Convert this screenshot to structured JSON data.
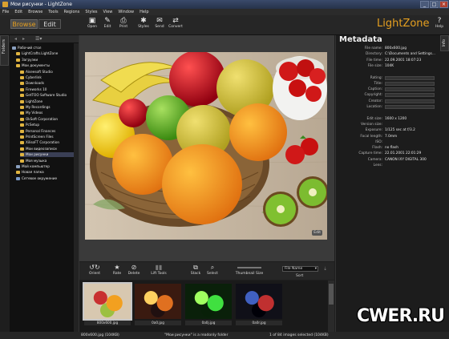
{
  "window": {
    "title": "Мои рисунки - LightZone"
  },
  "menu": [
    "File",
    "Edit",
    "Browse",
    "Tools",
    "Regions",
    "Styles",
    "View",
    "Window",
    "Help"
  ],
  "modes": {
    "browse": "Browse",
    "edit": "Edit"
  },
  "toolbar": [
    {
      "icon": "open-icon",
      "label": "Open"
    },
    {
      "icon": "edit-icon",
      "label": "Edit"
    },
    {
      "icon": "print-icon",
      "label": "Print"
    },
    {
      "icon": "styles-icon",
      "label": "Styles"
    },
    {
      "icon": "send-icon",
      "label": "Send"
    },
    {
      "icon": "convert-icon",
      "label": "Convert"
    }
  ],
  "brand": "LightZone",
  "help_label": "Help",
  "side_tabs": {
    "left": "Folders",
    "right": "Info"
  },
  "folders": [
    {
      "label": "Рабочий стол",
      "indent": 0,
      "kind": "pc"
    },
    {
      "label": "LightCrafts.LightZone",
      "indent": 1,
      "kind": "folder"
    },
    {
      "label": "Загрузки",
      "indent": 1,
      "kind": "folder"
    },
    {
      "label": "Мои документы",
      "indent": 1,
      "kind": "folder"
    },
    {
      "label": "Aiseesoft Studio",
      "indent": 2,
      "kind": "folder"
    },
    {
      "label": "Cyberlink",
      "indent": 2,
      "kind": "folder"
    },
    {
      "label": "Downloads",
      "indent": 2,
      "kind": "folder"
    },
    {
      "label": "Fireworks 10",
      "indent": 2,
      "kind": "folder"
    },
    {
      "label": "GetTOO Software Studio",
      "indent": 2,
      "kind": "folder"
    },
    {
      "label": "LightZone",
      "indent": 2,
      "kind": "folder"
    },
    {
      "label": "My Recordings",
      "indent": 2,
      "kind": "folder"
    },
    {
      "label": "My Videos",
      "indent": 2,
      "kind": "folder"
    },
    {
      "label": "OkSoft Corporation",
      "indent": 2,
      "kind": "folder"
    },
    {
      "label": "PcSetup",
      "indent": 2,
      "kind": "folder"
    },
    {
      "label": "Personal Finances",
      "indent": 2,
      "kind": "folder"
    },
    {
      "label": "PrintScreen Files",
      "indent": 2,
      "kind": "folder"
    },
    {
      "label": "XilisoFT Corporation",
      "indent": 2,
      "kind": "folder"
    },
    {
      "label": "Мои видеозаписи",
      "indent": 2,
      "kind": "folder"
    },
    {
      "label": "Мои рисунки",
      "indent": 2,
      "kind": "folder",
      "selected": true
    },
    {
      "label": "Моя музыка",
      "indent": 2,
      "kind": "folder"
    },
    {
      "label": "Мой компьютер",
      "indent": 1,
      "kind": "pc"
    },
    {
      "label": "Новая папка",
      "indent": 1,
      "kind": "folder"
    },
    {
      "label": "Сетевое окружение",
      "indent": 1,
      "kind": "net"
    }
  ],
  "viewer": {
    "edit_badge": "Edit"
  },
  "browse_controls": [
    {
      "icon": "rotate-left-icon",
      "label": "Orient"
    },
    {
      "icon": "star-icon",
      "label": "Rate"
    },
    {
      "icon": "delete-icon",
      "label": "Delete"
    },
    {
      "icon": "lift-tools-icon",
      "label": "Lift Tools"
    },
    {
      "icon": "stack-icon",
      "label": "Stack"
    },
    {
      "icon": "select-icon",
      "label": "Select"
    },
    {
      "icon": "thumbnail-size-slider",
      "label": "Thumbnail Size"
    }
  ],
  "sort": {
    "selected": "File Name",
    "label": "Sort"
  },
  "thumbnails": [
    {
      "caption": "800x600.jpg",
      "selected": true,
      "colors": [
        "#d8c8b0",
        "#f2a020",
        "#c83030",
        "#9cc040"
      ]
    },
    {
      "caption": "0a0.jpg",
      "selected": false,
      "colors": [
        "#3a1a10",
        "#e07020",
        "#ffd060",
        "#201010"
      ]
    },
    {
      "caption": "0a0j.jpg",
      "selected": false,
      "colors": [
        "#0a200a",
        "#40e040",
        "#a0ff60",
        "#082008"
      ]
    },
    {
      "caption": "0a0r.jpg",
      "selected": false,
      "colors": [
        "#101018",
        "#c03030",
        "#4060c0",
        "#000008"
      ]
    }
  ],
  "metadata": {
    "title": "Metadata",
    "rows": [
      {
        "key": "File name:",
        "value": "800x600.jpg"
      },
      {
        "key": "Directory:",
        "value": "C:\\Documents and Settings..."
      },
      {
        "key": "File time:",
        "value": "22.09.2001 18:07:23"
      },
      {
        "key": "File size:",
        "value": "104K"
      },
      {
        "key": "",
        "value": ""
      },
      {
        "key": "Rating:",
        "value": "",
        "field": true
      },
      {
        "key": "Title:",
        "value": "",
        "field": true
      },
      {
        "key": "Caption:",
        "value": "",
        "field": true
      },
      {
        "key": "Copyright:",
        "value": "",
        "field": true
      },
      {
        "key": "Creator:",
        "value": "",
        "field": true
      },
      {
        "key": "Location:",
        "value": "",
        "field": true
      },
      {
        "key": "",
        "value": ""
      },
      {
        "key": "Edit size:",
        "value": "1600 x 1200"
      },
      {
        "key": "Version size:",
        "value": ""
      },
      {
        "key": "Exposure:",
        "value": "1/125 sec at f/3.2"
      },
      {
        "key": "Focal length:",
        "value": "7.0mm"
      },
      {
        "key": "ISO:",
        "value": ""
      },
      {
        "key": "Flash:",
        "value": "no flash"
      },
      {
        "key": "Capture time:",
        "value": "22.01.2001 22:01:29"
      },
      {
        "key": "Camera:",
        "value": "CANON IXY DIGITAL 300"
      },
      {
        "key": "Lens:",
        "value": ""
      }
    ]
  },
  "status": {
    "left": "800x600.jpg (104KB)",
    "center": "\"Мои рисунки\" is a readonly folder",
    "right": "1 of 84 images selected (104KB)"
  },
  "watermark": "CWER.RU"
}
